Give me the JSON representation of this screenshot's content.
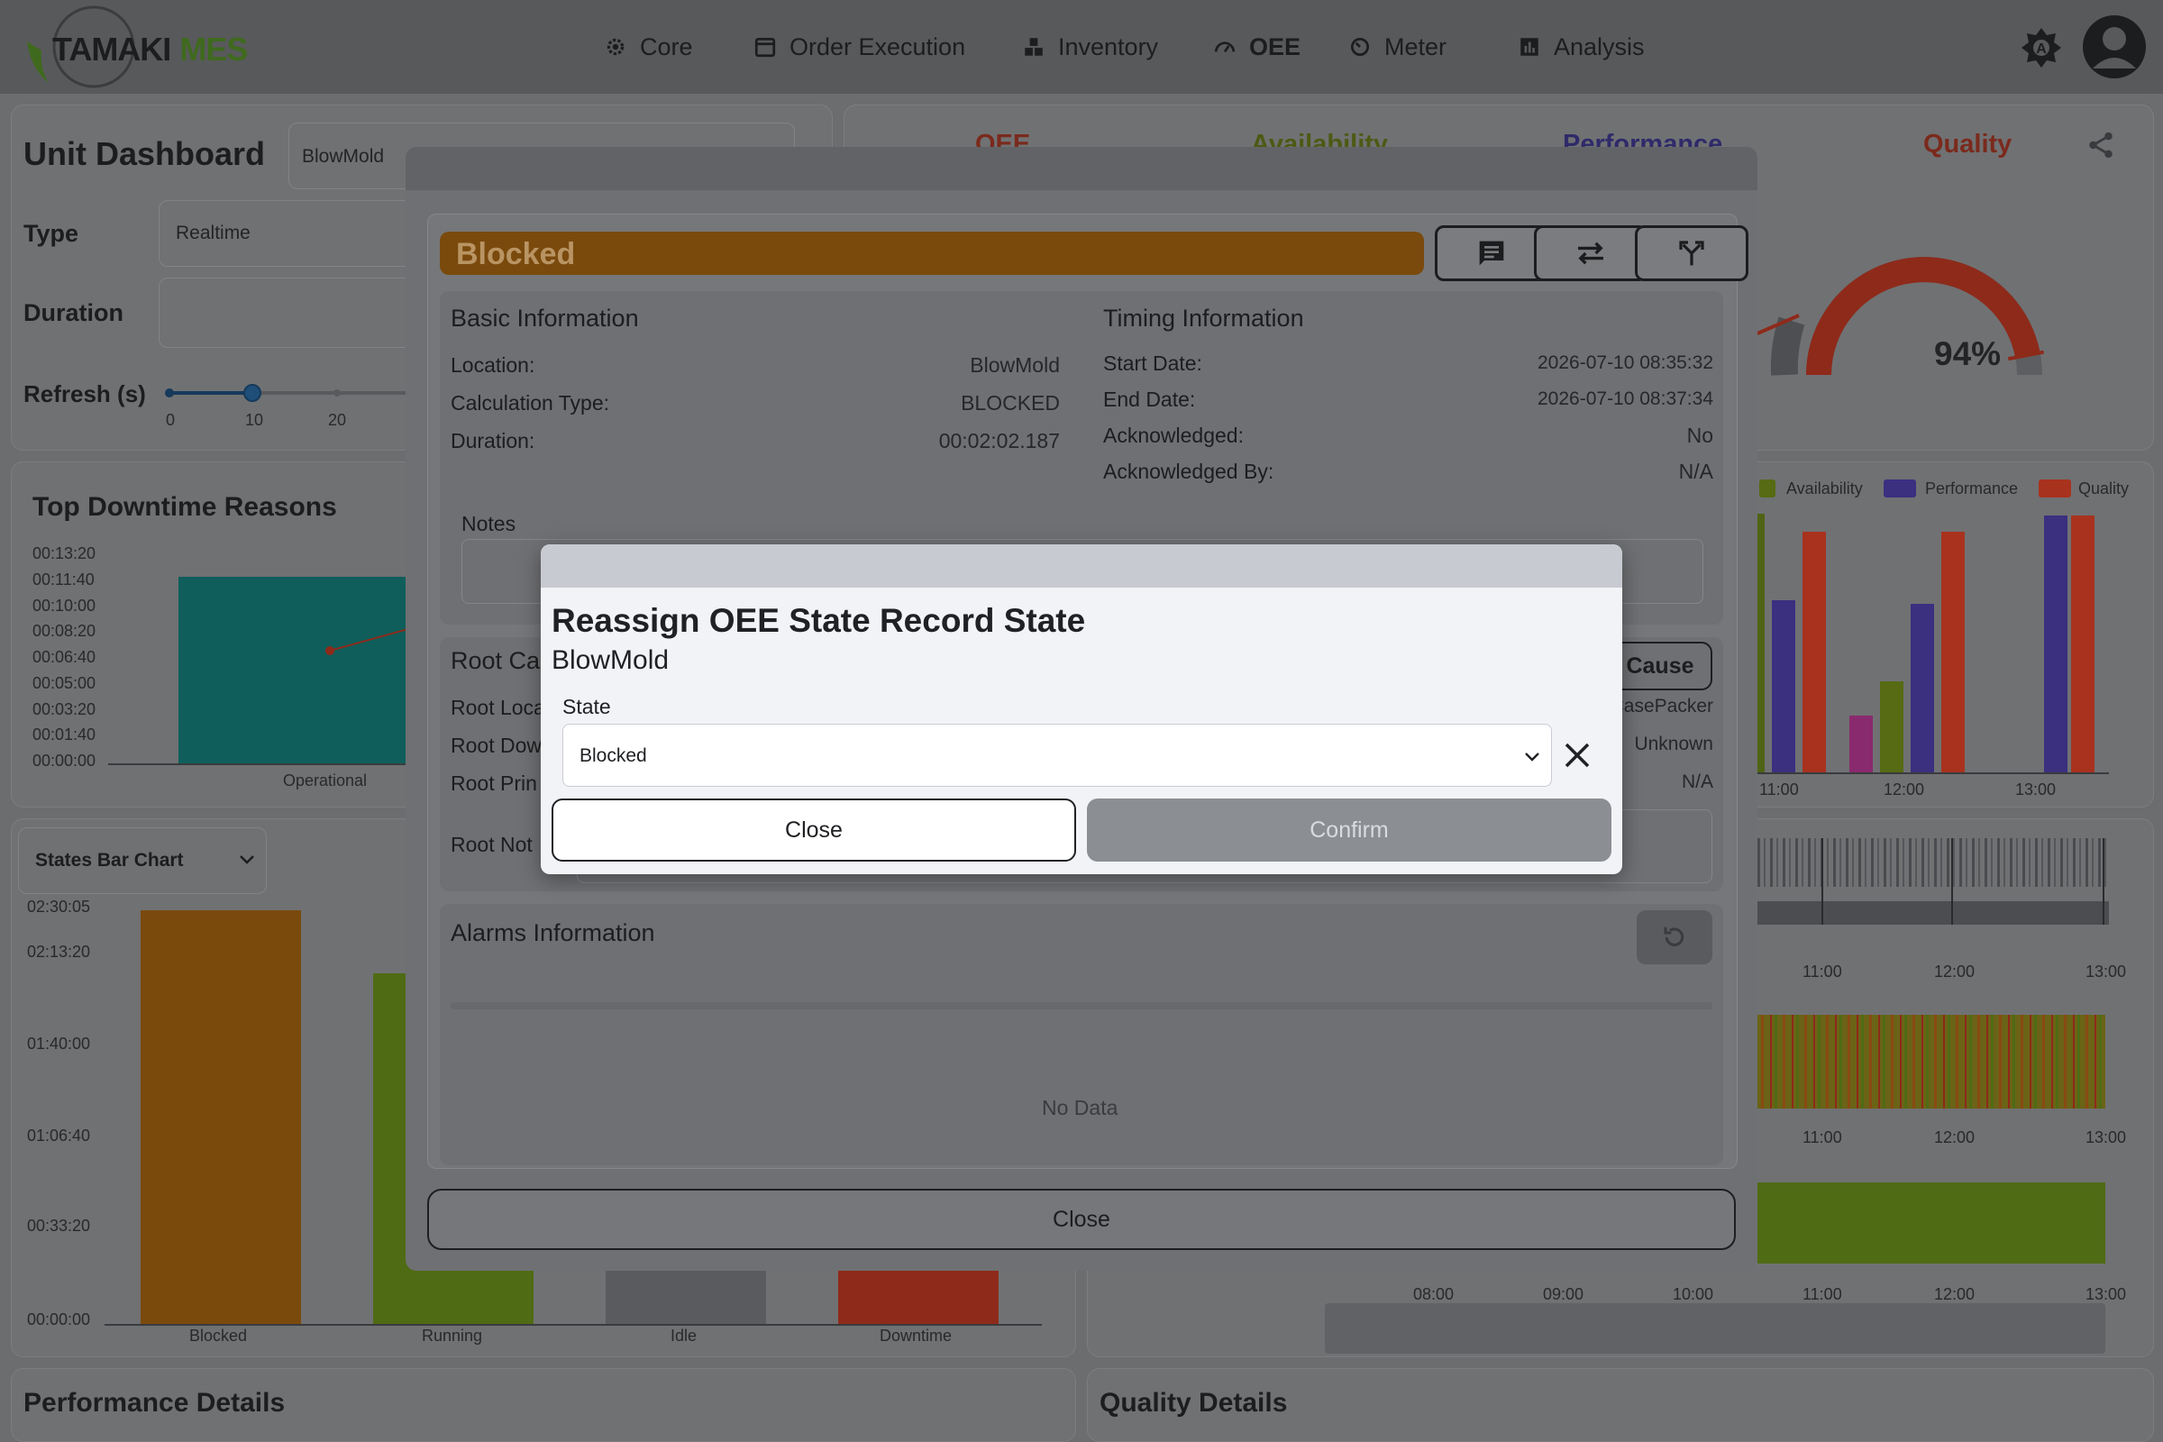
{
  "nav": {
    "brand_a": "TAMAKI",
    "brand_b": "MES",
    "items": [
      {
        "label": "Core",
        "icon": "gear-icon"
      },
      {
        "label": "Order Execution",
        "icon": "calendar-icon"
      },
      {
        "label": "Inventory",
        "icon": "boxes-icon"
      },
      {
        "label": "OEE",
        "icon": "speedometer-icon"
      },
      {
        "label": "Meter",
        "icon": "meter-icon"
      },
      {
        "label": "Analysis",
        "icon": "chart-icon"
      }
    ]
  },
  "dashboard": {
    "title": "Unit Dashboard",
    "unit_value": "BlowMold",
    "type_label": "Type",
    "type_value": "Realtime",
    "duration_label": "Duration",
    "refresh_label": "Refresh (s)",
    "refresh_ticks": [
      "0",
      "10",
      "20"
    ],
    "kpi_tabs": [
      "OEE",
      "Availability",
      "Performance",
      "Quality"
    ],
    "quality_gauge": {
      "label": "94%",
      "value": 94
    },
    "legend": [
      "Availability",
      "Performance",
      "Quality"
    ],
    "top_downtime_title": "Top Downtime Reasons",
    "downtime_yticks": [
      "00:13:20",
      "00:11:40",
      "00:10:00",
      "00:08:20",
      "00:06:40",
      "00:05:00",
      "00:03:20",
      "00:01:40",
      "00:00:00"
    ],
    "downtime_category": "Operational",
    "states_chart_select": "States Bar Chart",
    "states_yticks": [
      "02:30:05",
      "02:13:20",
      "01:40:00",
      "01:06:40",
      "00:33:20",
      "00:00:00"
    ],
    "states_categories": [
      "Blocked",
      "Running",
      "Idle",
      "Downtime"
    ],
    "time_ticks": [
      "11:00",
      "12:00",
      "13:00"
    ],
    "timeline_ticks": [
      "08:00",
      "09:00",
      "10:00",
      "11:00",
      "12:00",
      "13:00"
    ],
    "performance_title": "Performance Details",
    "quality_title": "Quality Details",
    "colors": {
      "blocked": "#7a4a0d",
      "running": "#4f6b14",
      "idle": "#5a5b5e",
      "downtime": "#8e2a1a",
      "availability": "#566b14",
      "performance": "#3b2f80",
      "quality": "#a8321e"
    }
  },
  "record": {
    "state": "Blocked",
    "basic_title": "Basic Information",
    "basic": [
      {
        "k": "Location:",
        "v": "BlowMold"
      },
      {
        "k": "Calculation Type:",
        "v": "BLOCKED"
      },
      {
        "k": "Duration:",
        "v": "00:02:02.187"
      }
    ],
    "timing_title": "Timing Information",
    "timing": [
      {
        "k": "Start Date:",
        "v": "2026-07-10 08:35:32"
      },
      {
        "k": "End Date:",
        "v": "2026-07-10 08:37:34"
      },
      {
        "k": "Acknowledged:",
        "v": "No"
      },
      {
        "k": "Acknowledged By:",
        "v": "N/A"
      }
    ],
    "notes_label": "Notes",
    "root_title": "Root Ca",
    "root_cause_btn": "Cause",
    "root_rows": [
      {
        "k": "Root Loca",
        "v": "CasePacker"
      },
      {
        "k": "Root Dow",
        "v": "Unknown"
      },
      {
        "k": "Root Prin",
        "v": "N/A"
      }
    ],
    "root_notes": "Root Not",
    "alarms_title": "Alarms Information",
    "alarms_empty": "No Data",
    "close_label": "Close"
  },
  "dialog": {
    "title": "Reassign OEE State Record State",
    "subtitle": "BlowMold",
    "state_label": "State",
    "state_value": "Blocked",
    "close_label": "Close",
    "confirm_label": "Confirm"
  }
}
